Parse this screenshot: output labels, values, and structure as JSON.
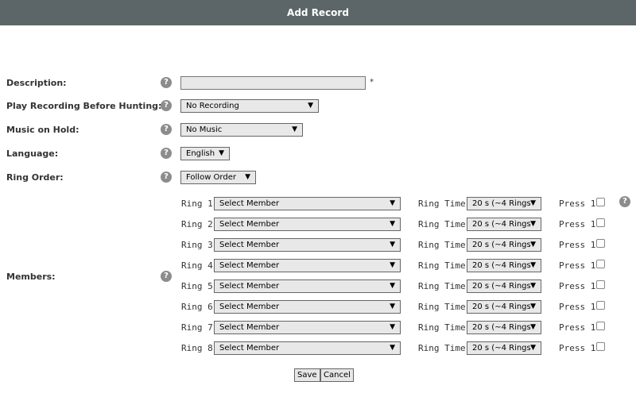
{
  "title": "Add Record",
  "fields": {
    "description": {
      "label": "Description:",
      "value": "",
      "required_mark": "*"
    },
    "play_recording": {
      "label": "Play Recording Before Hunting:",
      "value": "No Recording"
    },
    "music_on_hold": {
      "label": "Music on Hold:",
      "value": "No Music"
    },
    "language": {
      "label": "Language:",
      "value": "English"
    },
    "ring_order": {
      "label": "Ring Order:",
      "value": "Follow Order"
    },
    "members": {
      "label": "Members:"
    }
  },
  "help_glyph": "?",
  "arrow_glyph": "▼",
  "rings": [
    {
      "label": "Ring 1:",
      "member": "Select Member",
      "time_label": "Ring Time:",
      "time": "20 s (~4 Rings",
      "press_label": "Press 1:"
    },
    {
      "label": "Ring 2:",
      "member": "Select Member",
      "time_label": "Ring Time:",
      "time": "20 s (~4 Rings",
      "press_label": "Press 1:"
    },
    {
      "label": "Ring 3:",
      "member": "Select Member",
      "time_label": "Ring Time:",
      "time": "20 s (~4 Rings",
      "press_label": "Press 1:"
    },
    {
      "label": "Ring 4:",
      "member": "Select Member",
      "time_label": "Ring Time:",
      "time": "20 s (~4 Rings",
      "press_label": "Press 1:"
    },
    {
      "label": "Ring 5:",
      "member": "Select Member",
      "time_label": "Ring Time:",
      "time": "20 s (~4 Rings",
      "press_label": "Press 1:"
    },
    {
      "label": "Ring 6:",
      "member": "Select Member",
      "time_label": "Ring Time:",
      "time": "20 s (~4 Rings",
      "press_label": "Press 1:"
    },
    {
      "label": "Ring 7:",
      "member": "Select Member",
      "time_label": "Ring Time:",
      "time": "20 s (~4 Rings",
      "press_label": "Press 1:"
    },
    {
      "label": "Ring 8:",
      "member": "Select Member",
      "time_label": "Ring Time:",
      "time": "20 s (~4 Rings",
      "press_label": "Press 1:"
    }
  ],
  "buttons": {
    "save": "Save",
    "cancel": "Cancel"
  }
}
